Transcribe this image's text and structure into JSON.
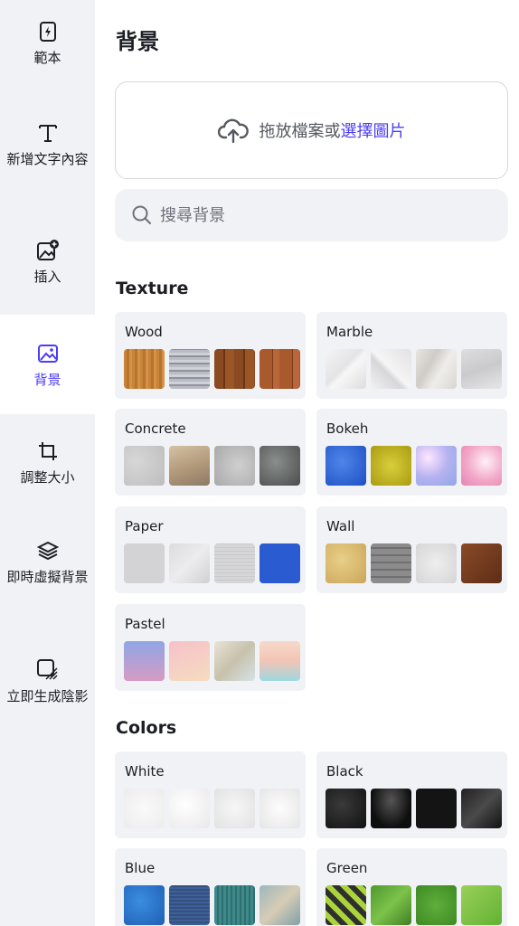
{
  "sidebar": {
    "items": [
      {
        "label": "範本",
        "icon": "template-icon"
      },
      {
        "label": "新增文字內容",
        "icon": "text-icon"
      },
      {
        "label": "插入",
        "icon": "insert-image-icon"
      },
      {
        "label": "背景",
        "icon": "background-icon",
        "active": true
      },
      {
        "label": "調整大小",
        "icon": "crop-icon"
      },
      {
        "label": "即時虛擬背景",
        "icon": "layers-icon"
      },
      {
        "label": "立即生成陰影",
        "icon": "shadow-icon"
      }
    ]
  },
  "main": {
    "title": "背景",
    "upload": {
      "prompt": "拖放檔案或",
      "link": "選擇圖片",
      "icon": "upload-cloud-icon"
    },
    "search": {
      "placeholder": "搜尋背景",
      "value": "",
      "icon": "search-icon"
    },
    "sections": [
      {
        "title": "Texture",
        "cards": [
          {
            "name": "Wood"
          },
          {
            "name": "Marble"
          },
          {
            "name": "Concrete"
          },
          {
            "name": "Bokeh"
          },
          {
            "name": "Paper"
          },
          {
            "name": "Wall"
          },
          {
            "name": "Pastel"
          }
        ]
      },
      {
        "title": "Colors",
        "cards": [
          {
            "name": "White"
          },
          {
            "name": "Black"
          },
          {
            "name": "Blue"
          },
          {
            "name": "Green"
          }
        ]
      }
    ]
  },
  "colors": {
    "accent": "#4b3cf5",
    "sidebar_bg": "#f1f2f5",
    "card_bg": "#f1f2f5"
  }
}
